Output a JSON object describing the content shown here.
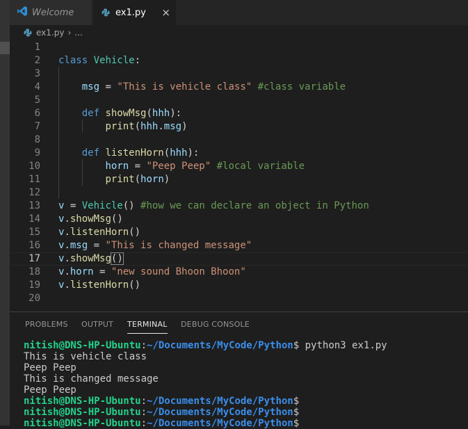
{
  "tabs": [
    {
      "label": "Welcome",
      "icon": "vscode-logo-icon",
      "active": false
    },
    {
      "label": "ex1.py",
      "icon": "python-icon",
      "active": true,
      "close": "×"
    }
  ],
  "breadcrumb": {
    "file": "ex1.py",
    "separator": "›",
    "more": "..."
  },
  "editor": {
    "current_line": 17,
    "lines": [
      {
        "n": "1"
      },
      {
        "n": "2",
        "t": [
          [
            "kw",
            "class"
          ],
          [
            "p",
            " "
          ],
          [
            "cls",
            "Vehicle"
          ],
          [
            "p",
            ":"
          ]
        ]
      },
      {
        "n": "3"
      },
      {
        "n": "4",
        "t": [
          [
            "p",
            "    "
          ],
          [
            "prm",
            "msg"
          ],
          [
            "p",
            " = "
          ],
          [
            "str",
            "\"This is vehicle class\""
          ],
          [
            "p",
            " "
          ],
          [
            "cmt",
            "#class variable"
          ]
        ]
      },
      {
        "n": "5"
      },
      {
        "n": "6",
        "t": [
          [
            "p",
            "    "
          ],
          [
            "kw",
            "def"
          ],
          [
            "p",
            " "
          ],
          [
            "fn",
            "showMsg"
          ],
          [
            "p",
            "("
          ],
          [
            "prm",
            "hhh"
          ],
          [
            "p",
            "):"
          ]
        ]
      },
      {
        "n": "7",
        "t": [
          [
            "p",
            "        "
          ],
          [
            "fn",
            "print"
          ],
          [
            "p",
            "("
          ],
          [
            "prm",
            "hhh"
          ],
          [
            "p",
            "."
          ],
          [
            "prm",
            "msg"
          ],
          [
            "p",
            ")"
          ]
        ]
      },
      {
        "n": "8"
      },
      {
        "n": "9",
        "t": [
          [
            "p",
            "    "
          ],
          [
            "kw",
            "def"
          ],
          [
            "p",
            " "
          ],
          [
            "fn",
            "listenHorn"
          ],
          [
            "p",
            "("
          ],
          [
            "prm",
            "hhh"
          ],
          [
            "p",
            "):"
          ]
        ]
      },
      {
        "n": "10",
        "t": [
          [
            "p",
            "        "
          ],
          [
            "prm",
            "horn"
          ],
          [
            "p",
            " = "
          ],
          [
            "str",
            "\"Peep Peep\""
          ],
          [
            "p",
            " "
          ],
          [
            "cmt",
            "#local variable"
          ]
        ]
      },
      {
        "n": "11",
        "t": [
          [
            "p",
            "        "
          ],
          [
            "fn",
            "print"
          ],
          [
            "p",
            "("
          ],
          [
            "prm",
            "horn"
          ],
          [
            "p",
            ")"
          ]
        ]
      },
      {
        "n": "12"
      },
      {
        "n": "13",
        "t": [
          [
            "prm",
            "v"
          ],
          [
            "p",
            " = "
          ],
          [
            "cls",
            "Vehicle"
          ],
          [
            "p",
            "() "
          ],
          [
            "cmt",
            "#how we can declare an object in Python"
          ]
        ]
      },
      {
        "n": "14",
        "t": [
          [
            "prm",
            "v"
          ],
          [
            "p",
            "."
          ],
          [
            "fn",
            "showMsg"
          ],
          [
            "p",
            "()"
          ]
        ]
      },
      {
        "n": "15",
        "t": [
          [
            "prm",
            "v"
          ],
          [
            "p",
            "."
          ],
          [
            "fn",
            "listenHorn"
          ],
          [
            "p",
            "()"
          ]
        ]
      },
      {
        "n": "16",
        "t": [
          [
            "prm",
            "v"
          ],
          [
            "p",
            "."
          ],
          [
            "prm",
            "msg"
          ],
          [
            "p",
            " = "
          ],
          [
            "str",
            "\"This is changed message\""
          ]
        ]
      },
      {
        "n": "17",
        "t": [
          [
            "prm",
            "v"
          ],
          [
            "p",
            "."
          ],
          [
            "fn",
            "showMsg"
          ],
          [
            "bracket",
            "()"
          ]
        ]
      },
      {
        "n": "18",
        "t": [
          [
            "prm",
            "v"
          ],
          [
            "p",
            "."
          ],
          [
            "prm",
            "horn"
          ],
          [
            "p",
            " = "
          ],
          [
            "str",
            "\"new sound Bhoon Bhoon\""
          ]
        ]
      },
      {
        "n": "19",
        "t": [
          [
            "prm",
            "v"
          ],
          [
            "p",
            "."
          ],
          [
            "fn",
            "listenHorn"
          ],
          [
            "p",
            "()"
          ]
        ]
      },
      {
        "n": "20"
      }
    ]
  },
  "panel": {
    "tabs": [
      {
        "label": "PROBLEMS",
        "active": false
      },
      {
        "label": "OUTPUT",
        "active": false
      },
      {
        "label": "TERMINAL",
        "active": true
      },
      {
        "label": "DEBUG CONSOLE",
        "active": false
      }
    ]
  },
  "terminal": {
    "lines": [
      {
        "user": "nitish@DNS-HP-Ubuntu",
        "sep": ":",
        "path": "~/Documents/MyCode/Python",
        "dollar": "$",
        "cmd": " python3 ex1.py"
      },
      {
        "text": "This is vehicle class"
      },
      {
        "text": "Peep Peep"
      },
      {
        "text": "This is changed message"
      },
      {
        "text": "Peep Peep"
      },
      {
        "user": "nitish@DNS-HP-Ubuntu",
        "sep": ":",
        "path": "~/Documents/MyCode/Python",
        "dollar": "$",
        "cmd": ""
      },
      {
        "user": "nitish@DNS-HP-Ubuntu",
        "sep": ":",
        "path": "~/Documents/MyCode/Python",
        "dollar": "$",
        "cmd": ""
      },
      {
        "user": "nitish@DNS-HP-Ubuntu",
        "sep": ":",
        "path": "~/Documents/MyCode/Python",
        "dollar": "$",
        "cmd": ""
      }
    ]
  },
  "colors": {
    "keyword": "#569cd6",
    "class": "#4ec9b0",
    "function": "#dcdcaa",
    "variable": "#9cdcfe",
    "string": "#ce9178",
    "comment": "#6a9955",
    "prompt_user": "#23d18b",
    "prompt_path": "#3b8eea"
  }
}
